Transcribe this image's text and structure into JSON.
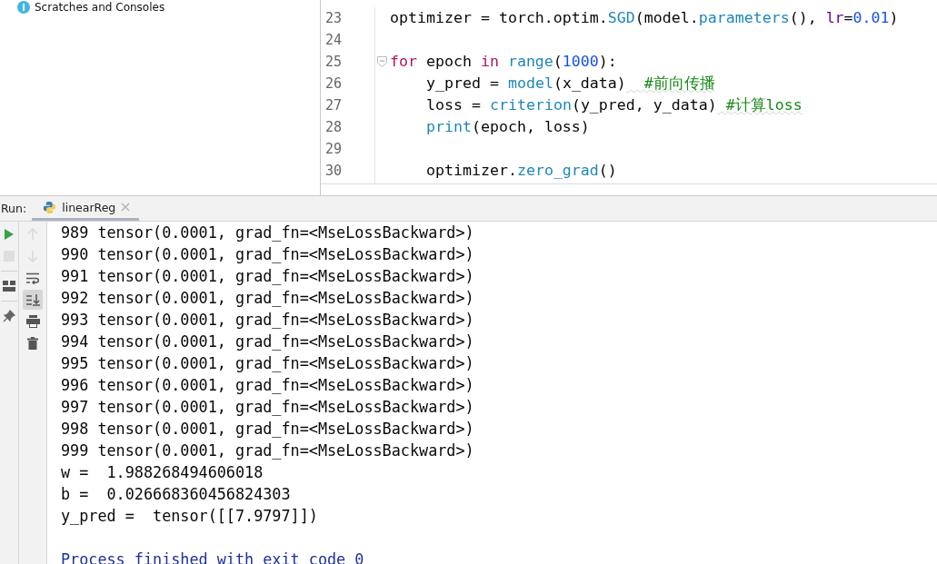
{
  "project_panel": {
    "items": [
      {
        "label": "Scratches and Consoles"
      }
    ]
  },
  "editor": {
    "lines": [
      {
        "number": "23",
        "fold": false,
        "indented": false,
        "tokens": [
          {
            "text": "optimizer",
            "kind": "plain"
          },
          {
            "text": " = ",
            "kind": "op"
          },
          {
            "text": "torch",
            "kind": "plain"
          },
          {
            "text": ".",
            "kind": "op"
          },
          {
            "text": "optim",
            "kind": "plain"
          },
          {
            "text": ".",
            "kind": "op"
          },
          {
            "text": "SGD",
            "kind": "call"
          },
          {
            "text": "(",
            "kind": "op"
          },
          {
            "text": "model",
            "kind": "plain"
          },
          {
            "text": ".",
            "kind": "op"
          },
          {
            "text": "parameters",
            "kind": "call"
          },
          {
            "text": "()",
            "kind": "op"
          },
          {
            "text": ", ",
            "kind": "plain"
          },
          {
            "text": "lr",
            "kind": "param"
          },
          {
            "text": "=",
            "kind": "op"
          },
          {
            "text": "0.01",
            "kind": "number"
          },
          {
            "text": ")",
            "kind": "op"
          }
        ]
      },
      {
        "number": "24",
        "fold": false
      },
      {
        "number": "25",
        "fold": true,
        "indented": false,
        "tokens": [
          {
            "text": "for",
            "kind": "keyword"
          },
          {
            "text": " epoch ",
            "kind": "plain"
          },
          {
            "text": "in",
            "kind": "keyword"
          },
          {
            "text": " range",
            "kind": "call"
          },
          {
            "text": "(",
            "kind": "op"
          },
          {
            "text": "1000",
            "kind": "number"
          },
          {
            "text": "):",
            "kind": "op"
          }
        ]
      },
      {
        "number": "26",
        "fold": false,
        "indented": true,
        "tokens": [
          {
            "text": "y_pred",
            "kind": "plain"
          },
          {
            "text": " = ",
            "kind": "op"
          },
          {
            "text": "model",
            "kind": "call"
          },
          {
            "text": "(",
            "kind": "op"
          },
          {
            "text": "x_data",
            "kind": "plain"
          },
          {
            "text": ")",
            "kind": "op"
          },
          {
            "text": "  #前向传播",
            "kind": "comment"
          }
        ]
      },
      {
        "number": "27",
        "fold": false,
        "indented": true,
        "tokens": [
          {
            "text": "loss",
            "kind": "plain"
          },
          {
            "text": " = ",
            "kind": "op"
          },
          {
            "text": "criterion",
            "kind": "call"
          },
          {
            "text": "(",
            "kind": "op"
          },
          {
            "text": "y_pred, y_data",
            "kind": "plain"
          },
          {
            "text": ")",
            "kind": "op"
          },
          {
            "text": " #计算loss",
            "kind": "comment"
          }
        ]
      },
      {
        "number": "28",
        "fold": false,
        "indented": true,
        "tokens": [
          {
            "text": "print",
            "kind": "call"
          },
          {
            "text": "(",
            "kind": "op"
          },
          {
            "text": "epoch, loss",
            "kind": "plain"
          },
          {
            "text": ")",
            "kind": "op"
          }
        ]
      },
      {
        "number": "29",
        "fold": false
      },
      {
        "number": "30",
        "fold": false,
        "indented": true,
        "tokens": [
          {
            "text": "optimizer",
            "kind": "plain"
          },
          {
            "text": ".",
            "kind": "op"
          },
          {
            "text": "zero_grad",
            "kind": "call"
          },
          {
            "text": "()",
            "kind": "op"
          }
        ]
      }
    ]
  },
  "run_panel": {
    "label": "Run:",
    "tabs": [
      {
        "label": "linearReg",
        "selected": true
      }
    ]
  },
  "tools_left": [
    {
      "kind": "run",
      "disabled": false
    },
    {
      "kind": "stop",
      "disabled": true
    },
    {
      "kind": "layout",
      "disabled": false
    },
    {
      "kind": "pin",
      "disabled": false
    }
  ],
  "tools_right": [
    {
      "kind": "up",
      "disabled": true,
      "on": false
    },
    {
      "kind": "down",
      "disabled": true,
      "on": false
    },
    {
      "kind": "wrap",
      "disabled": false,
      "on": false
    },
    {
      "kind": "scroll-end",
      "disabled": false,
      "on": true
    },
    {
      "kind": "print",
      "disabled": false,
      "on": false
    },
    {
      "kind": "trash",
      "disabled": false,
      "on": false
    }
  ],
  "console": [
    {
      "text": "989 tensor(0.0001, grad_fn=<MseLossBackward>)",
      "kind": "output"
    },
    {
      "text": "990 tensor(0.0001, grad_fn=<MseLossBackward>)",
      "kind": "output"
    },
    {
      "text": "991 tensor(0.0001, grad_fn=<MseLossBackward>)",
      "kind": "output"
    },
    {
      "text": "992 tensor(0.0001, grad_fn=<MseLossBackward>)",
      "kind": "output"
    },
    {
      "text": "993 tensor(0.0001, grad_fn=<MseLossBackward>)",
      "kind": "output"
    },
    {
      "text": "994 tensor(0.0001, grad_fn=<MseLossBackward>)",
      "kind": "output"
    },
    {
      "text": "995 tensor(0.0001, grad_fn=<MseLossBackward>)",
      "kind": "output"
    },
    {
      "text": "996 tensor(0.0001, grad_fn=<MseLossBackward>)",
      "kind": "output"
    },
    {
      "text": "997 tensor(0.0001, grad_fn=<MseLossBackward>)",
      "kind": "output"
    },
    {
      "text": "998 tensor(0.0001, grad_fn=<MseLossBackward>)",
      "kind": "output"
    },
    {
      "text": "999 tensor(0.0001, grad_fn=<MseLossBackward>)",
      "kind": "output"
    },
    {
      "text": "w =  1.988268494606018",
      "kind": "output"
    },
    {
      "text": "b =  0.026668360456824303",
      "kind": "output"
    },
    {
      "text": "y_pred =  tensor([[7.9797]])",
      "kind": "output"
    },
    {
      "kind": "blank"
    },
    {
      "text": "Process finished with exit code 0",
      "kind": "system"
    }
  ]
}
